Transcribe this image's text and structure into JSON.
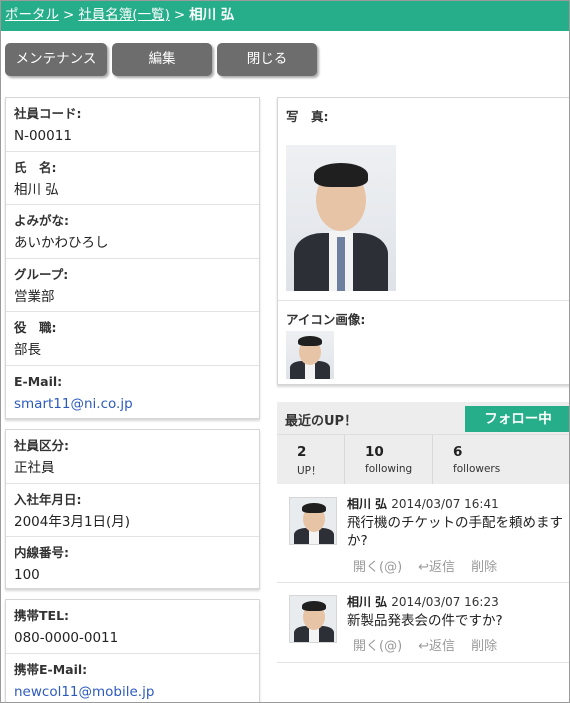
{
  "breadcrumb": {
    "portal": "ポータル",
    "sep1": ">",
    "directory": "社員名簿(一覧)",
    "sep2": ">",
    "current": "相川 弘"
  },
  "toolbar": {
    "maintenance": "メンテナンス",
    "edit": "編集",
    "close": "閉じる"
  },
  "profile": [
    {
      "label": "社員コード:",
      "value": "N-00011"
    },
    {
      "label": "氏　名:",
      "value": "相川 弘"
    },
    {
      "label": "よみがな:",
      "value": "あいかわひろし"
    },
    {
      "label": "グループ:",
      "value": "営業部"
    },
    {
      "label": "役　職:",
      "value": "部長"
    },
    {
      "label": "E-Mail:",
      "value": "smart11@ni.co.jp"
    }
  ],
  "employment": [
    {
      "label": "社員区分:",
      "value": "正社員"
    },
    {
      "label": "入社年月日:",
      "value": "2004年3月1日(月)"
    },
    {
      "label": "内線番号:",
      "value": "100"
    }
  ],
  "mobile": [
    {
      "label": "携帯TEL:",
      "value": "080-0000-0011"
    },
    {
      "label": "携帯E-Mail:",
      "value": "newcol11@mobile.jp"
    }
  ],
  "photo": {
    "label": "写　真:",
    "icon_label": "アイコン画像:"
  },
  "up": {
    "title": "最近のUP！",
    "follow": "フォロー中",
    "stats": [
      {
        "num": "2",
        "cap": "UP！"
      },
      {
        "num": "10",
        "cap": "following"
      },
      {
        "num": "6",
        "cap": "followers"
      }
    ],
    "posts": [
      {
        "name": "相川 弘",
        "time": "2014/03/07 16:41",
        "message": "飛行機のチケットの手配を頼めますか?",
        "open": "開く(@)",
        "reply": "↩返信",
        "delete": "削除"
      },
      {
        "name": "相川 弘",
        "time": "2014/03/07 16:23",
        "message": "新製品発表会の件ですか?",
        "open": "開く(@)",
        "reply": "↩返信",
        "delete": "削除"
      }
    ]
  },
  "colors": {
    "accent": "#26ad8a",
    "button": "#6d6d6d",
    "link": "#2d5bbd"
  }
}
